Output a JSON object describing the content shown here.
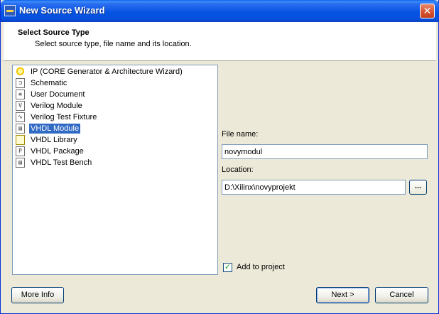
{
  "window": {
    "title": "New Source Wizard",
    "close_glyph": "✕"
  },
  "header": {
    "title": "Select Source Type",
    "subtitle": "Select source type, file name and its location."
  },
  "source_types": [
    {
      "label": "IP (CORE Generator & Architecture Wizard)",
      "icon": "lightbulb-icon",
      "glyph": ""
    },
    {
      "label": "Schematic",
      "icon": "schematic-icon",
      "glyph": "⊐"
    },
    {
      "label": "User Document",
      "icon": "document-icon",
      "glyph": "≡"
    },
    {
      "label": "Verilog Module",
      "icon": "verilog-module-icon",
      "glyph": "V"
    },
    {
      "label": "Verilog Test Fixture",
      "icon": "verilog-test-fixture-icon",
      "glyph": "∿"
    },
    {
      "label": "VHDL Module",
      "icon": "vhdl-module-icon",
      "glyph": "▤",
      "selected": true
    },
    {
      "label": "VHDL Library",
      "icon": "vhdl-library-icon",
      "glyph": ""
    },
    {
      "label": "VHDL Package",
      "icon": "vhdl-package-icon",
      "glyph": "P"
    },
    {
      "label": "VHDL Test Bench",
      "icon": "vhdl-test-bench-icon",
      "glyph": "▤"
    }
  ],
  "form": {
    "file_name_label": "File name:",
    "file_name_value": "novymodul",
    "location_label": "Location:",
    "location_value": "D:\\Xilinx\\novyprojekt",
    "browse_label": "...",
    "add_to_project_label": "Add to project",
    "add_to_project_checked": true
  },
  "buttons": {
    "more_info": "More Info",
    "next": "Next >",
    "cancel": "Cancel"
  },
  "colors": {
    "selection": "#316ac5",
    "title_bar": "#0754e3",
    "dialog_bg": "#ece9d8"
  }
}
